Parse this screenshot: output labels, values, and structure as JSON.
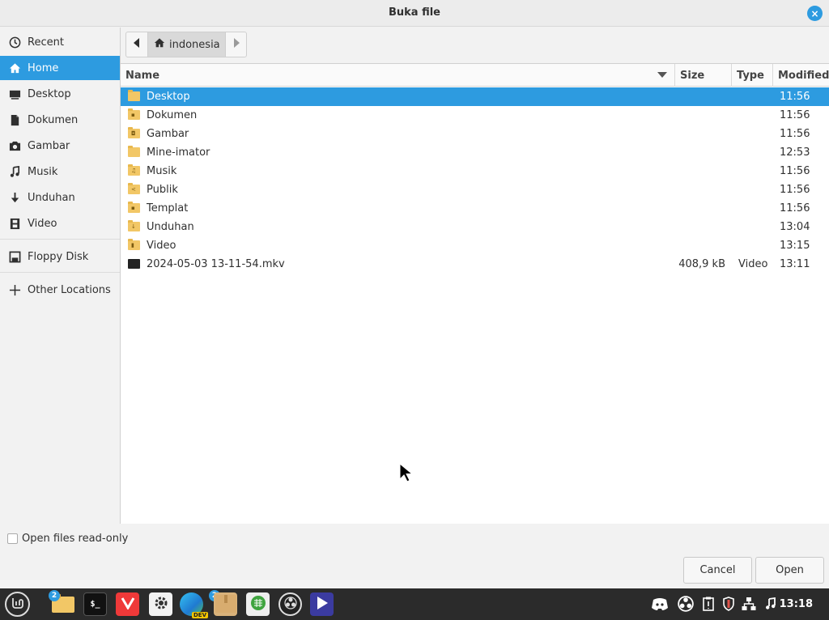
{
  "window": {
    "title": "Buka file",
    "close_label": "×"
  },
  "sidebar": {
    "items": [
      {
        "label": "Recent",
        "icon": "clock-icon"
      },
      {
        "label": "Home",
        "icon": "home-icon"
      },
      {
        "label": "Desktop",
        "icon": "desktop-icon"
      },
      {
        "label": "Dokumen",
        "icon": "document-icon"
      },
      {
        "label": "Gambar",
        "icon": "camera-icon"
      },
      {
        "label": "Musik",
        "icon": "music-icon"
      },
      {
        "label": "Unduhan",
        "icon": "download-icon"
      },
      {
        "label": "Video",
        "icon": "film-icon"
      },
      {
        "label": "Floppy Disk",
        "icon": "floppy-icon"
      },
      {
        "label": "Other Locations",
        "icon": "plus-icon"
      }
    ],
    "active": "Home"
  },
  "pathbar": {
    "current": "indonesia"
  },
  "columns": {
    "name": "Name",
    "size": "Size",
    "type": "Type",
    "modified": "Modified"
  },
  "files": [
    {
      "name": "Desktop",
      "size": "",
      "type": "",
      "modified": "11:56",
      "kind": "folder",
      "glyph": ""
    },
    {
      "name": "Dokumen",
      "size": "",
      "type": "",
      "modified": "11:56",
      "kind": "folder",
      "glyph": "▪"
    },
    {
      "name": "Gambar",
      "size": "",
      "type": "",
      "modified": "11:56",
      "kind": "folder",
      "glyph": "◘"
    },
    {
      "name": "Mine-imator",
      "size": "",
      "type": "",
      "modified": "12:53",
      "kind": "folder",
      "glyph": ""
    },
    {
      "name": "Musik",
      "size": "",
      "type": "",
      "modified": "11:56",
      "kind": "folder",
      "glyph": "♫"
    },
    {
      "name": "Publik",
      "size": "",
      "type": "",
      "modified": "11:56",
      "kind": "folder",
      "glyph": "<"
    },
    {
      "name": "Templat",
      "size": "",
      "type": "",
      "modified": "11:56",
      "kind": "folder",
      "glyph": "▪"
    },
    {
      "name": "Unduhan",
      "size": "",
      "type": "",
      "modified": "13:04",
      "kind": "folder",
      "glyph": "↓"
    },
    {
      "name": "Video",
      "size": "",
      "type": "",
      "modified": "13:15",
      "kind": "folder",
      "glyph": "▮"
    },
    {
      "name": "2024-05-03 13-11-54.mkv",
      "size": "408,9 kB",
      "type": "Video",
      "modified": "13:11",
      "kind": "video",
      "glyph": ""
    }
  ],
  "selected_file": "Desktop",
  "options": {
    "readonly_label": "Open files read-only",
    "readonly_checked": false
  },
  "buttons": {
    "cancel": "Cancel",
    "open": "Open"
  },
  "taskbar": {
    "apps": [
      {
        "name": "menu",
        "badge": ""
      },
      {
        "name": "files",
        "badge": "2"
      },
      {
        "name": "terminal",
        "badge": ""
      },
      {
        "name": "vivaldi",
        "badge": ""
      },
      {
        "name": "settings",
        "badge": ""
      },
      {
        "name": "edge-dev",
        "badge": "2",
        "sub": "DEV"
      },
      {
        "name": "archive",
        "badge": ""
      },
      {
        "name": "spreadsheet",
        "badge": ""
      },
      {
        "name": "obs",
        "badge": ""
      },
      {
        "name": "media-player",
        "badge": ""
      }
    ],
    "tray": [
      "discord-icon",
      "obs-icon",
      "clipboard-icon",
      "shield-icon",
      "network-icon",
      "music-icon"
    ],
    "clock": "13:18"
  },
  "colors": {
    "accent": "#2d9be0",
    "folder": "#f2c766",
    "taskbar": "#2b2b2b"
  }
}
